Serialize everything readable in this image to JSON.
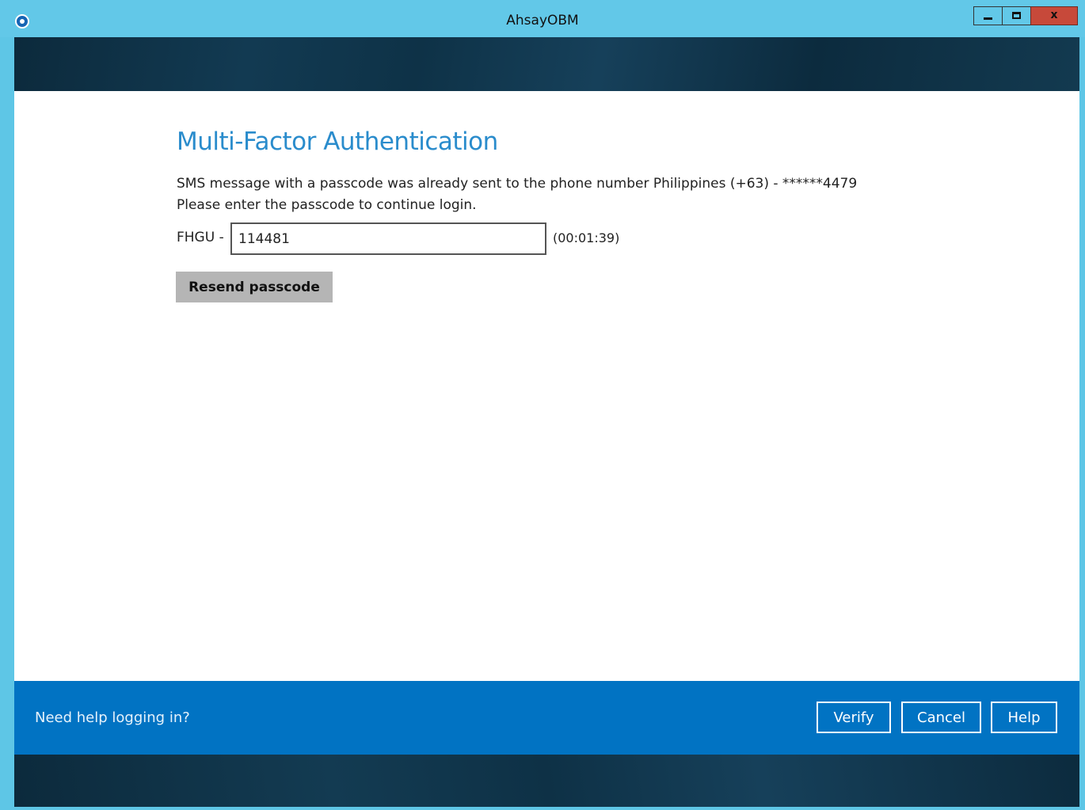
{
  "window": {
    "title": "AhsayOBM",
    "controls": {
      "minimize": "minimize-icon",
      "maximize": "maximize-icon",
      "close": "x"
    }
  },
  "mfa": {
    "heading": "Multi-Factor Authentication",
    "message_line1": "SMS message with a passcode was already sent to the phone number Philippines (+63) - ******4479",
    "message_line2": "Please enter the passcode to continue login.",
    "prefix": "FHGU -",
    "passcode_value": "114481",
    "timer": "(00:01:39)",
    "resend_label": "Resend passcode"
  },
  "footer": {
    "help_link": "Need help logging in?",
    "verify_label": "Verify",
    "cancel_label": "Cancel",
    "help_label": "Help"
  },
  "colors": {
    "titlebar": "#62c8e8",
    "heading": "#2a8ccc",
    "footer": "#0173c3",
    "banner": "#0c2a3c",
    "close_button": "#c7493a"
  }
}
